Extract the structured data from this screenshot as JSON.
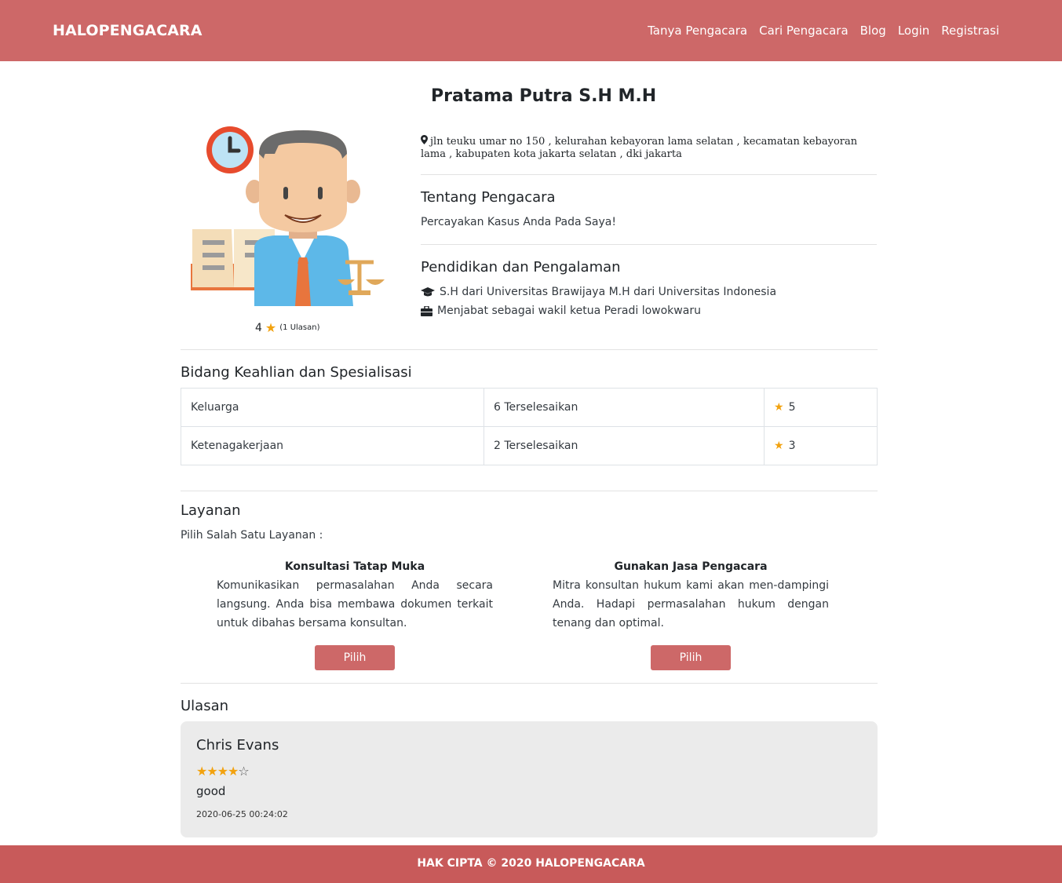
{
  "nav": {
    "brand": "HALOPENGACARA",
    "links": [
      "Tanya Pengacara",
      "Cari Pengacara",
      "Blog",
      "Login",
      "Registrasi"
    ]
  },
  "profile": {
    "name": "Pratama Putra S.H M.H",
    "rating_value": "4",
    "rating_count": "(1 Ulasan)",
    "address": "jln teuku umar no 150 , kelurahan kebayoran lama selatan , kecamatan kebayoran lama , kabupaten kota jakarta selatan , dki jakarta",
    "about_heading": "Tentang Pengacara",
    "about_text": "Percayakan Kasus Anda Pada Saya!",
    "education_heading": "Pendidikan dan Pengalaman",
    "education_text": "S.H dari Universitas Brawijaya M.H dari Universitas Indonesia",
    "experience_text": "Menjabat sebagai wakil ketua Peradi lowokwaru"
  },
  "skills": {
    "heading": "Bidang Keahlian dan Spesialisasi",
    "rows": [
      {
        "area": "Keluarga",
        "completed": "6 Terselesaikan",
        "rating": "5"
      },
      {
        "area": "Ketenagakerjaan",
        "completed": "2 Terselesaikan",
        "rating": "3"
      }
    ]
  },
  "services": {
    "heading": "Layanan",
    "subheading": "Pilih Salah Satu Layanan :",
    "items": [
      {
        "title": "Konsultasi Tatap Muka",
        "description": "Komunikasikan permasalahan Anda secara langsung. Anda bisa membawa dokumen terkait untuk dibahas bersama konsultan.",
        "button": "Pilih"
      },
      {
        "title": "Gunakan Jasa Pengacara",
        "description": "Mitra konsultan hukum kami akan men-dampingi Anda. Hadapi permasalahan hukum dengan tenang dan optimal.",
        "button": "Pilih"
      }
    ]
  },
  "reviews": {
    "heading": "Ulasan",
    "items": [
      {
        "name": "Chris Evans",
        "stars": 4,
        "max_stars": 5,
        "text": "good",
        "date": "2020-06-25 00:24:02"
      }
    ]
  },
  "footer": {
    "text": "HAK CIPTA © 2020 HALOPENGACARA"
  },
  "colors": {
    "brand": "#cd6868",
    "footer": "#c85a5a",
    "star": "#f2a20f"
  },
  "icons": {
    "address": "map-marker-icon",
    "education": "graduation-cap-icon",
    "experience": "briefcase-icon",
    "rating": "star-icon"
  }
}
